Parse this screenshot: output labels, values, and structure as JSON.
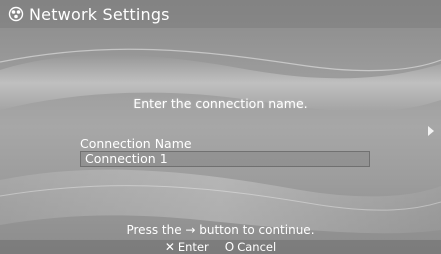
{
  "header": {
    "icon": "network-settings-icon",
    "title": "Network Settings"
  },
  "dialog": {
    "prompt": "Enter the connection name.",
    "field_label": "Connection Name",
    "field_value": "Connection 1",
    "continue_text": "Press the → button to continue."
  },
  "footer": {
    "enter": {
      "glyph": "✕",
      "label": "Enter"
    },
    "cancel": {
      "glyph": "O",
      "label": "Cancel"
    }
  },
  "colors": {
    "background": "#9a9a9a",
    "text": "#ffffff"
  }
}
